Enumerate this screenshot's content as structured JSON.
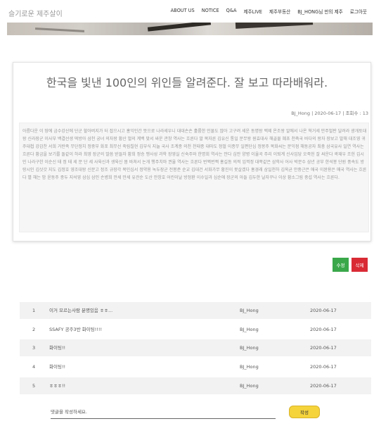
{
  "nav": {
    "brand": "슬기로운 제주살이",
    "menu": [
      "ABOUT US",
      "NOTICE",
      "Q&A",
      "제주LIVE",
      "제주부동산",
      "BJ_HONG님 만의 제주",
      "로그아웃"
    ]
  },
  "post": {
    "title": "한국을 빛낸 100인의 위인들 알려준다. 잘 보고 따라배워라.",
    "meta": "BJ_Hong | 2020-06-17 | 조회수 : 13",
    "content": "아름다운 이 땅에 금수강산에 단군 할아버지가 터 잡으시고 홍익인간 뜻으로 나라세우니 대대손손 훌륭한 인물도 많아 고구려 세운 동명왕 백제 온조왕 알에서 나온 혁거세 만주벌판 달려라 광개토대왕 신라장군 이사부 백결선생 떡방아 삼천 궁녀 의자왕 황산 벌의 계백 맞서 싸운 관창 역사는 흐른다 말 목자른 김유신 통일 문무왕 원효대사 해골물 혜초 천축국 바다의 왕자 장보고 발해 대조영 귀주대첩 강감찬 서희 거란족 무단정치 정중부 화포 최무선 죽림칠현 김부식 지눌 국사 조계종 의천 천태종 대마도 정벌 이종무 일편단심 정몽주 목화씨는 문익점 해동공자 최충 삼국유사 일연 역사는 흐른다 황금을 보기를 돌같이 하라 최영 장군의 말씀 받들자 황희 정승 맹사성 과학 장영실 신숙주와 한명회 역사는 안다 십만 양병 이율곡 주리 이퇴계 신사임당 오죽헌 잘 싸운다 곽재우 조헌 김시민 나라구한 이순신 태 정 태 세 문 단 세 사육신과 생육신 몸 바쳐서 논개 행주치마 권율 역사는 흐른다 번쩍번쩍 홍길동 의적 임꺽정 대쪽같은 삼학사 어사 박문수 삼년 공부 한석봉 단원 풍속도 방랑시인 김삿갓 지도 김정호 영조대왕 신문고 정조 규장각 목민심서 정약용 녹두장군 전봉준 순교 김대건 서화가무 황진이 못살겠다 홍경래 삼일천하 김옥균 안중근은 애국 이완용은 매국 역사는 흐른다 별 헤는 밤 윤동주 종두 지석영 삼십 삼인 손병희 만세 만세 유관순 도산 안창호 어린이날 방정환 이수일과 심순애 장군의 아들 김두한 날자꾸나 이상 황소그림 중섭 역사는 흐른다."
  },
  "buttons": {
    "edit": "수정",
    "delete": "삭제",
    "submit": "작성"
  },
  "comments": [
    {
      "num": "1",
      "text": "이거 모르는사람 분명있음 ㅎㅎ...",
      "user": "BJ_Hong",
      "date": "2020-06-17"
    },
    {
      "num": "2",
      "text": "SSAFY 공주3반 화이팅!!!!",
      "user": "BJ_Hong",
      "date": "2020-06-17"
    },
    {
      "num": "3",
      "text": "화이팅!!",
      "user": "BJ_Hong",
      "date": "2020-06-17"
    },
    {
      "num": "4",
      "text": "화이팅!!",
      "user": "BJ_Hong",
      "date": "2020-06-17"
    },
    {
      "num": "5",
      "text": "ㅎㅎㅎ!!",
      "user": "BJ_Hong",
      "date": "2020-06-17"
    }
  ],
  "comment_input": {
    "placeholder": "댓글을 작성하세요."
  },
  "colors": {
    "edit": "#3aa84a",
    "delete": "#d92b35",
    "submit": "#f5d33b",
    "row_alt": "#f2f2f2"
  }
}
